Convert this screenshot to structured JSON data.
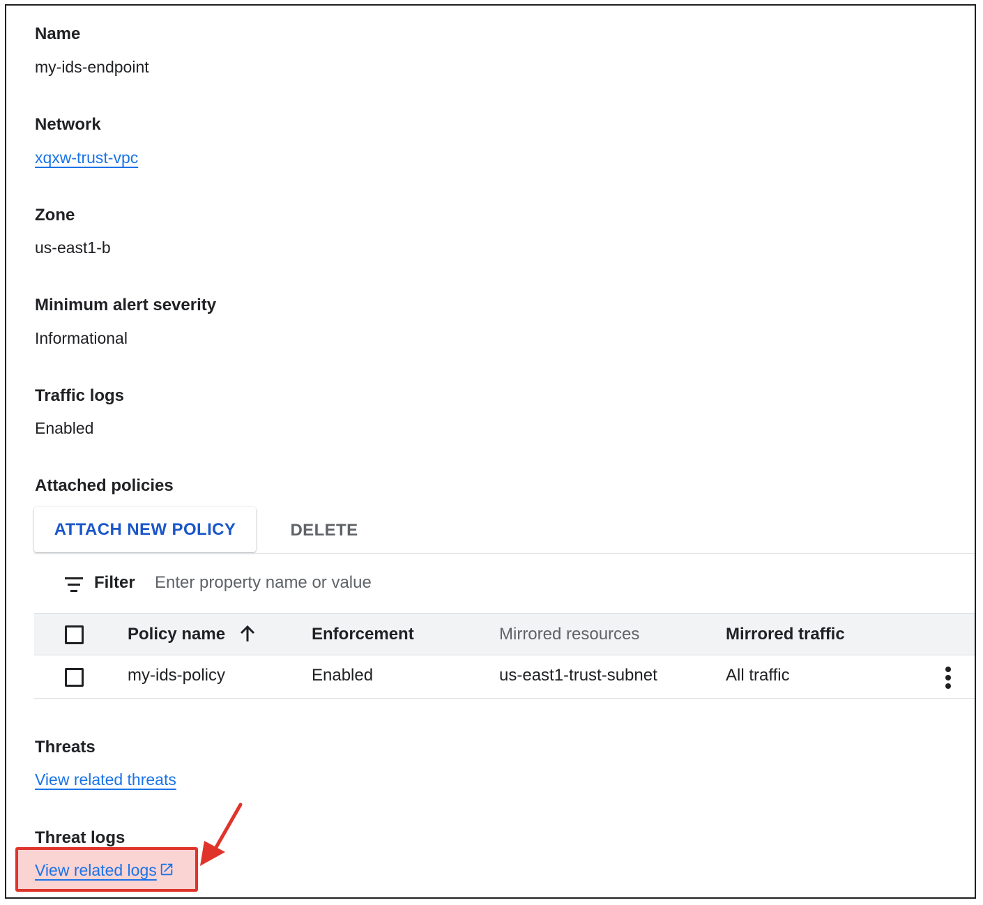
{
  "details": {
    "name": {
      "label": "Name",
      "value": "my-ids-endpoint"
    },
    "network": {
      "label": "Network",
      "value": "xqxw-trust-vpc"
    },
    "zone": {
      "label": "Zone",
      "value": "us-east1-b"
    },
    "severity": {
      "label": "Minimum alert severity",
      "value": "Informational"
    },
    "traffic_logs": {
      "label": "Traffic logs",
      "value": "Enabled"
    }
  },
  "attached_policies": {
    "label": "Attached policies",
    "attach_button": "ATTACH NEW POLICY",
    "delete_button": "DELETE",
    "filter": {
      "label": "Filter",
      "placeholder": "Enter property name or value"
    },
    "columns": [
      "Policy name",
      "Enforcement",
      "Mirrored resources",
      "Mirrored traffic"
    ],
    "rows": [
      {
        "policy_name": "my-ids-policy",
        "enforcement": "Enabled",
        "mirrored_resources": "us-east1-trust-subnet",
        "mirrored_traffic": "All traffic"
      }
    ]
  },
  "threats": {
    "label": "Threats",
    "link": "View related threats"
  },
  "threat_logs": {
    "label": "Threat logs",
    "link": "View related logs"
  },
  "colors": {
    "link": "#1a73e8",
    "accent_button": "#1a56c9",
    "highlight": "#e0342b",
    "header_bg": "#f1f3f4"
  },
  "icons": [
    "filter-icon",
    "sort-arrow-up-icon",
    "more-vert-icon",
    "open-in-new-icon",
    "annotation-arrow"
  ]
}
